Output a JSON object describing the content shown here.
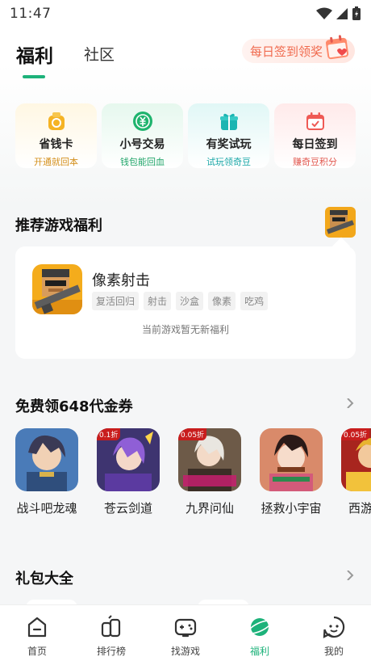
{
  "status_bar": {
    "time": "11:47"
  },
  "header": {
    "tabs": [
      {
        "label": "福利",
        "active": true
      },
      {
        "label": "社区",
        "active": false
      }
    ],
    "checkin_banner": "每日签到领奖"
  },
  "feature_cards": [
    {
      "title": "省钱卡",
      "subtitle": "开通就回本",
      "icon": "coin-bag-icon",
      "color": "#f5b324"
    },
    {
      "title": "小号交易",
      "subtitle": "钱包能回血",
      "icon": "yuan-exchange-icon",
      "color": "#1fb46e"
    },
    {
      "title": "有奖试玩",
      "subtitle": "试玩领奇豆",
      "icon": "gift-box-icon",
      "color": "#1bb5b2"
    },
    {
      "title": "每日签到",
      "subtitle": "赚奇豆积分",
      "icon": "calendar-check-icon",
      "color": "#ef5a55"
    }
  ],
  "recommended": {
    "title": "推荐游戏福利",
    "game": {
      "name": "像素射击",
      "tags": [
        "复活回归",
        "射击",
        "沙盒",
        "像素",
        "吃鸡"
      ],
      "empty_text": "当前游戏暂无新福利"
    }
  },
  "vouchers": {
    "title": "免费领648代金券",
    "games": [
      {
        "name": "战斗吧龙魂",
        "badge": ""
      },
      {
        "name": "苍云剑道",
        "badge": "0.1折"
      },
      {
        "name": "九界问仙",
        "badge": "0.05折"
      },
      {
        "name": "拯救小宇宙",
        "badge": ""
      },
      {
        "name": "西游记塔",
        "badge": "0.05折"
      }
    ]
  },
  "gift_packs": {
    "title": "礼包大全"
  },
  "bottom_nav": [
    {
      "label": "首页",
      "icon": "home-icon",
      "active": false
    },
    {
      "label": "排行榜",
      "icon": "leaderboard-icon",
      "active": false
    },
    {
      "label": "找游戏",
      "icon": "gamepad-icon",
      "active": false
    },
    {
      "label": "福利",
      "icon": "planet-icon",
      "active": true
    },
    {
      "label": "我的",
      "icon": "profile-face-icon",
      "active": false
    }
  ],
  "colors": {
    "accent_green": "#1db27a",
    "checkin_red": "#f06a4e"
  }
}
